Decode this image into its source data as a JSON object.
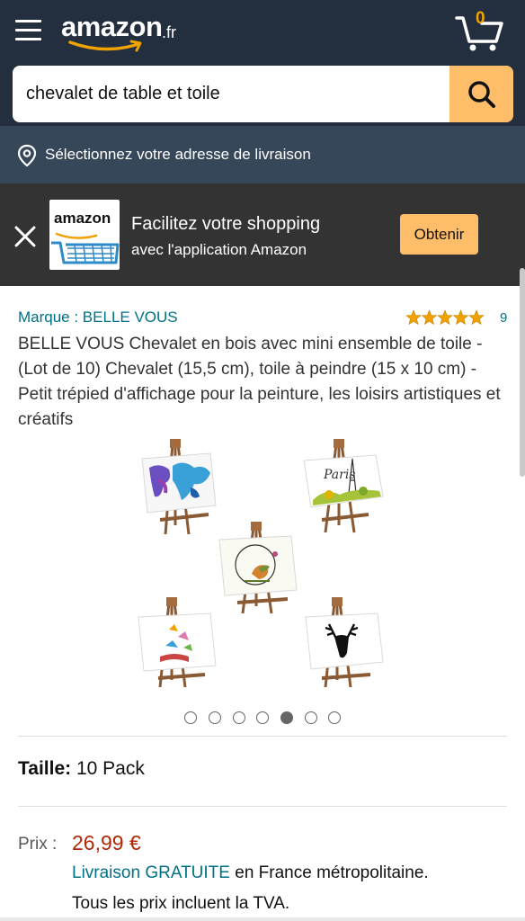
{
  "header": {
    "logo_text": "amazon",
    "logo_tld": ".fr",
    "cart_count": "0",
    "icons": {
      "menu": "hamburger-menu-icon",
      "cart": "shopping-cart-icon",
      "search": "search-icon"
    }
  },
  "search": {
    "value": "chevalet de table et toile"
  },
  "delivery": {
    "label": "Sélectionnez votre adresse de livraison",
    "icon": "location-pin-icon"
  },
  "app_banner": {
    "icon_word": "amazon",
    "title": "Facilitez votre shopping",
    "subtitle": "avec l'application Amazon",
    "button_label": "Obtenir"
  },
  "product": {
    "brand": "Marque : BELLE VOUS",
    "rating_stars": 5,
    "rating_count": "9",
    "title": "BELLE VOUS Chevalet en bois avec mini ensemble de toile - (Lot de 10) Chevalet (15,5 cm), toile à peindre (15 x 10 cm) - Petit trépied d'affichage pour la peinture, les loisirs artistiques et créatifs",
    "gallery": {
      "image_count": 7,
      "active_index": 4,
      "canvas_text": "Paris"
    },
    "size_label": "Taille:",
    "size_value": "10 Pack",
    "price_label": "Prix :",
    "price_value": "26,99 €",
    "shipping_link": "Livraison GRATUITE",
    "shipping_rest": " en France métropolitaine.",
    "tax_note": "Tous les prix incluent la TVA."
  },
  "colors": {
    "header_bg": "#232f3e",
    "delivery_bg": "#37475a",
    "banner_bg": "#333333",
    "accent": "#febd69",
    "link": "#007185",
    "price": "#b12704",
    "star": "#f0a300"
  }
}
